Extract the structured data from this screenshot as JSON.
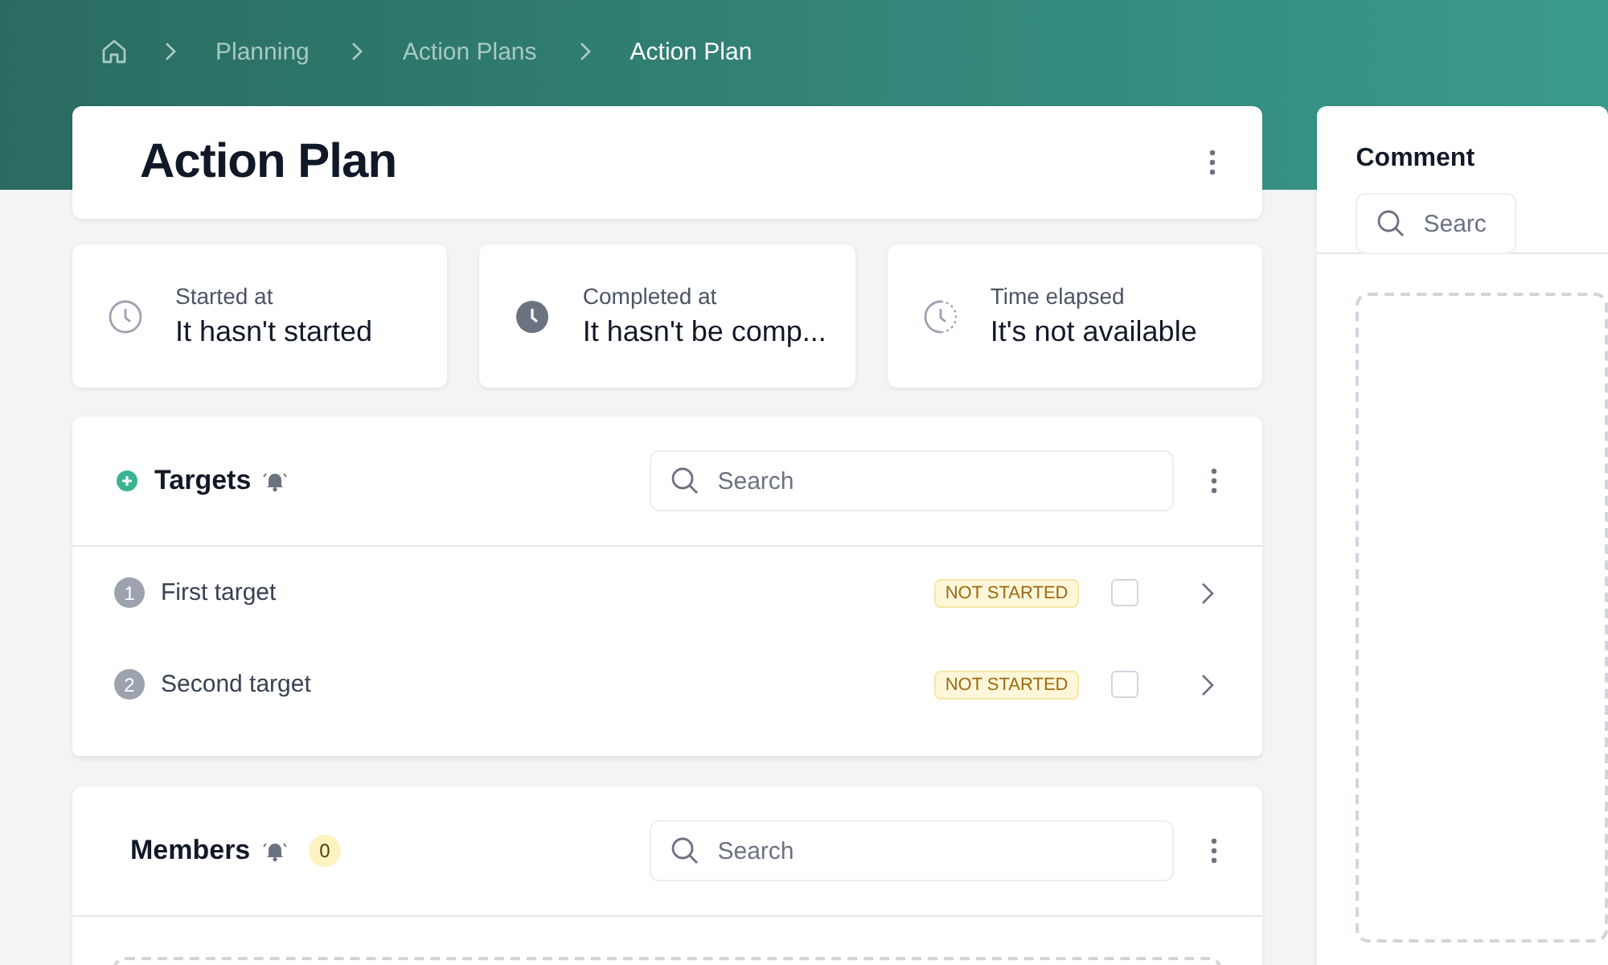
{
  "breadcrumbs": [
    {
      "label": "Planning",
      "current": false
    },
    {
      "label": "Action Plans",
      "current": false
    },
    {
      "label": "Action Plan",
      "current": true
    }
  ],
  "title": "Action Plan",
  "stats": [
    {
      "label": "Started at",
      "value": "It hasn't started",
      "kind": "outline"
    },
    {
      "label": "Completed at",
      "value": "It hasn't be comp...",
      "kind": "filled"
    },
    {
      "label": "Time elapsed",
      "value": "It's not available",
      "kind": "dashed"
    }
  ],
  "targets": {
    "title": "Targets",
    "search": {
      "placeholder": "Search"
    },
    "items": [
      {
        "number": "1",
        "name": "First target",
        "status": "NOT STARTED",
        "checked": false
      },
      {
        "number": "2",
        "name": "Second target",
        "status": "NOT STARTED",
        "checked": false
      }
    ]
  },
  "members": {
    "title": "Members",
    "count": "0",
    "search": {
      "placeholder": "Search"
    }
  },
  "comments": {
    "title": "Comment",
    "search": {
      "placeholder": "Searc"
    }
  }
}
